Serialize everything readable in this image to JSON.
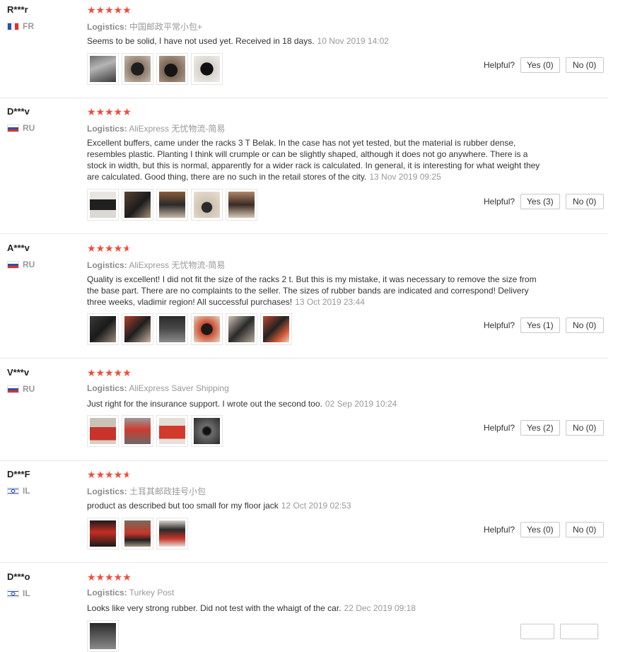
{
  "labels": {
    "logistics_prefix": "Logistics:",
    "helpful": "Helpful?"
  },
  "stars": {
    "full": "★★★★★",
    "color": "#f04b3a"
  },
  "reviews": [
    {
      "user": "R***r",
      "country": "FR",
      "rating": 5,
      "logistics": "中国邮政平常小包+",
      "text": "Seems to be solid, I have not used yet. Received in 18 days.",
      "date": "10 Nov 2019 14:02",
      "yes": "Yes (0)",
      "no": "No (0)"
    },
    {
      "user": "D***v",
      "country": "RU",
      "rating": 5,
      "logistics": "AliExpress 无忧物流-简易",
      "text": "Excellent buffers, came under the racks 3 T Belak. In the case has not yet tested, but the material is rubber dense, resembles plastic. Planting I think will crumple or can be slightly shaped, although it does not go anywhere. There is a stock in width, but this is normal, apparently for a wider rack is calculated. In general, it is interesting for what weight they are calculated. Good thing, there are no such in the retail stores of the city.",
      "date": "13 Nov 2019 09:25",
      "yes": "Yes (3)",
      "no": "No (0)"
    },
    {
      "user": "A***v",
      "country": "RU",
      "rating": 4.5,
      "logistics": "AliExpress 无忧物流-简易",
      "text": "Quality is excellent! I did not fit the size of the racks 2 t. But this is my mistake, it was necessary to remove the size from the base part. There are no complaints to the seller. The sizes of rubber bands are indicated and correspond! Delivery three weeks, vladimir region! All successful purchases!",
      "date": "13 Oct 2019 23:44",
      "yes": "Yes (1)",
      "no": "No (0)"
    },
    {
      "user": "V***v",
      "country": "RU",
      "rating": 5,
      "logistics": "AliExpress Saver Shipping",
      "text": "Just right for the insurance support. I wrote out the second too.",
      "date": "02 Sep 2019 10:24",
      "yes": "Yes (2)",
      "no": "No (0)"
    },
    {
      "user": "D***F",
      "country": "IL",
      "rating": 4.5,
      "logistics": "土耳其邮政挂号小包",
      "text": "product as described but too small for my floor jack",
      "date": "12 Oct 2019 02:53",
      "yes": "Yes (0)",
      "no": "No (0)"
    },
    {
      "user": "D***o",
      "country": "IL",
      "rating": 5,
      "logistics": "Turkey Post",
      "text": "Looks like very strong rubber. Did not test with the whaigt of the car.",
      "date": "22 Dec 2019 09:18",
      "yes": "",
      "no": ""
    }
  ]
}
